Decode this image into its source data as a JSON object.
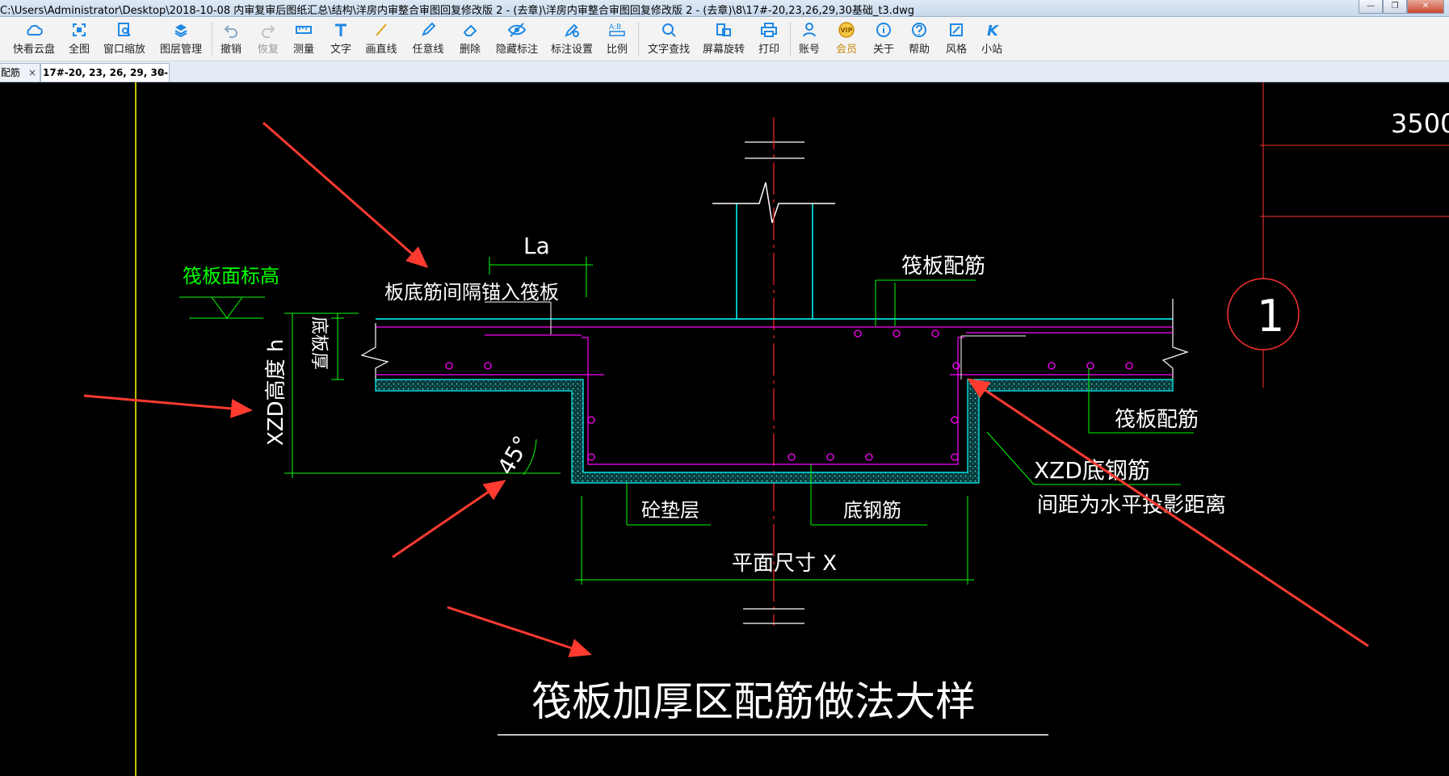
{
  "window": {
    "title": "C:\\Users\\Administrator\\Desktop\\2018-10-08 内审复审后图纸汇总\\结构\\洋房内审整合审图回复修改版 2 - (去章)\\洋房内审整合审图回复修改版 2 - (去章)\\8\\17#-20,23,26,29,30基础_t3.dwg",
    "minimize": "—",
    "restore": "❐",
    "close": "✕"
  },
  "toolbar": {
    "items": [
      {
        "label": "快看云盘",
        "icon": "cloud-icon"
      },
      {
        "label": "全图",
        "icon": "full-view-icon"
      },
      {
        "label": "窗口缩放",
        "icon": "window-zoom-icon"
      },
      {
        "label": "图层管理",
        "icon": "layers-icon"
      },
      {
        "label": "撤销",
        "icon": "undo-icon"
      },
      {
        "label": "恢复",
        "icon": "redo-icon"
      },
      {
        "label": "测量",
        "icon": "measure-icon"
      },
      {
        "label": "文字",
        "icon": "text-icon"
      },
      {
        "label": "画直线",
        "icon": "line-icon"
      },
      {
        "label": "任意线",
        "icon": "freehand-icon"
      },
      {
        "label": "删除",
        "icon": "eraser-icon"
      },
      {
        "label": "隐藏标注",
        "icon": "hide-eye-icon"
      },
      {
        "label": "标注设置",
        "icon": "annotation-settings-icon"
      },
      {
        "label": "比例",
        "icon": "scale-icon"
      },
      {
        "label": "文字查找",
        "icon": "text-search-icon"
      },
      {
        "label": "屏幕旋转",
        "icon": "rotate-screen-icon"
      },
      {
        "label": "打印",
        "icon": "print-icon"
      },
      {
        "label": "账号",
        "icon": "account-icon"
      },
      {
        "label": "会员",
        "icon": "vip-icon",
        "vip_badge": "VIP"
      },
      {
        "label": "关于",
        "icon": "info-icon"
      },
      {
        "label": "帮助",
        "icon": "help-icon"
      },
      {
        "label": "风格",
        "icon": "style-icon"
      },
      {
        "label": "小站",
        "icon": "k-site-icon",
        "k_glyph": "K"
      }
    ]
  },
  "tabs": [
    {
      "label": "配筋",
      "close": "×"
    },
    {
      "label": "17#-20, 23, 26, 29, 30-",
      "close": "×"
    }
  ],
  "drawing": {
    "title": "筏板加厚区配筋做法大样",
    "top_right_dim": "3500",
    "axis_bubble": "1",
    "labels": {
      "raft_top_elev": "筏板面标高",
      "slab_bottom_anchor": "板底筋间隔锚入筏板",
      "la": "La",
      "raft_rebar_top": "筏板配筋",
      "raft_thickness": "底板厚",
      "xzd_height": "XZD高度 h",
      "angle": "45°",
      "raft_rebar_right": "筏板配筋",
      "xzd_bottom_rebar": "XZD底钢筋",
      "spacing_note": "间距为水平投影距离",
      "cushion": "砼垫层",
      "bottom_rebar": "底钢筋",
      "plan_size": "平面尺寸 X"
    }
  },
  "colors": {
    "canvas_bg": "#000000",
    "dim_green": "#00ff00",
    "concrete_cyan": "#00ffff",
    "rebar_magenta": "#ff00ff",
    "center_red": "#ff2222",
    "annotation_arrow": "#ff3b30",
    "text_white": "#ffffff",
    "border_yellow": "#ffff00"
  }
}
